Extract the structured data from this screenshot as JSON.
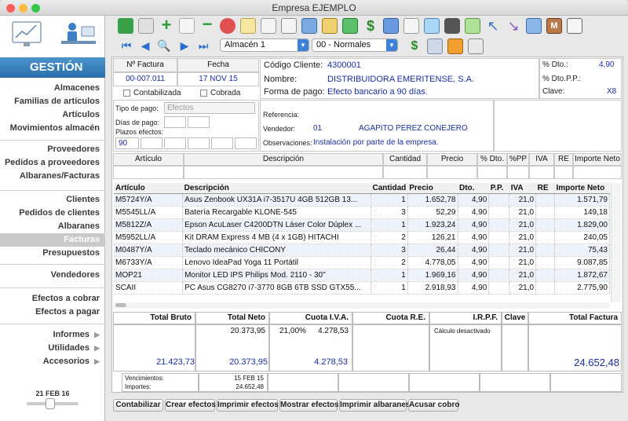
{
  "window": {
    "title": "Empresa EJEMPLO"
  },
  "sidebar": {
    "heading": "GESTIÓN",
    "group1": [
      "Almacenes",
      "Familias de artículos",
      "Artículos",
      "Movimientos almacén"
    ],
    "group2": [
      "Proveedores",
      "Pedidos a proveedores",
      "Albaranes/Facturas"
    ],
    "group3": [
      "Clientes",
      "Pedidos de clientes",
      "Albaranes",
      "Facturas",
      "Presupuestos"
    ],
    "group4": [
      "Vendedores"
    ],
    "group5": [
      "Efectos a cobrar",
      "Efectos a pagar"
    ],
    "group6": [
      "Informes",
      "Utilidades",
      "Accesorios"
    ],
    "date": "21 FEB 16"
  },
  "toolbar": {
    "almacen": "Almacén 1",
    "tarifa": "00 - Normales"
  },
  "header": {
    "nfactura_label": "Nº Factura",
    "fecha_label": "Fecha",
    "nfactura": "00-007.011",
    "fecha": "17 NOV 15",
    "contabilizada": "Contabilizada",
    "cobrada": "Cobrada",
    "codigo_label": "Código Cliente:",
    "codigo": "4300001",
    "nombre_label": "Nombre:",
    "nombre": "DISTRIBUIDORA EMERITENSE, S.A.",
    "forma_label": "Forma de pago:",
    "forma": "Efecto bancario a 90 días.",
    "dto_label": "% Dto.:",
    "dto": "4,90",
    "dtopp_label": "% Dto.P.P.:",
    "dtopp": "",
    "clave_label": "Clave:",
    "clave": "X8"
  },
  "payment": {
    "tipo_label": "Tipo de pago:",
    "tipo": "Efectos",
    "dias_label": "Días de pago:",
    "plazos_label": "Plazos efectos:",
    "plazo1": "90",
    "referencia_label": "Referencia:",
    "vendedor_label": "Vendedor:",
    "vendedor_code": "01",
    "vendedor_name": "AGAPITO PEREZ CONEJERO",
    "observ_label": "Observaciones:",
    "observ": "Instalación por parte de la empresa."
  },
  "entry_headers": [
    "Artículo",
    "Descripción",
    "Cantidad",
    "Precio",
    "% Dto.",
    "%PP",
    "IVA",
    "RE",
    "Importe Neto"
  ],
  "lines": {
    "columns": [
      "Artículo",
      "Descripción",
      "Cantidad",
      "Precio",
      "Dto.",
      "P.P.",
      "IVA",
      "RE",
      "Importe Neto"
    ],
    "rows": [
      [
        "M5724Y/A",
        "Asus Zenbook UX31A i7-3517U 4GB 512GB 13...",
        "1",
        "1.652,78",
        "4,90",
        "",
        "21,0",
        "",
        "1.571,79"
      ],
      [
        "M5545LL/A",
        "Batería Recargable KLONE-545",
        "3",
        "52,29",
        "4,90",
        "",
        "21,0",
        "",
        "149,18"
      ],
      [
        "M5812Z/A",
        "Epson AcuLaser C4200DTN Láser Color Dúplex ...",
        "1",
        "1.923,24",
        "4,90",
        "",
        "21,0",
        "",
        "1.829,00"
      ],
      [
        "M5952LL/A",
        "Kit DRAM Express 4 MB (4 x 1GB) HITACHI",
        "2",
        "126,21",
        "4,90",
        "",
        "21,0",
        "",
        "240,05"
      ],
      [
        "M0487Y/A",
        "Teclado mecánico CHICONY",
        "3",
        "26,44",
        "4,90",
        "",
        "21,0",
        "",
        "75,43"
      ],
      [
        "M6733Y/A",
        "Lenovo IdeaPad Yoga 11 Portátil",
        "2",
        "4.778,05",
        "4,90",
        "",
        "21,0",
        "",
        "9.087,85"
      ],
      [
        "MOP21",
        "Monitor LED IPS Philips Mod. 2110 - 30\"",
        "1",
        "1.969,16",
        "4,90",
        "",
        "21,0",
        "",
        "1.872,67"
      ],
      [
        "SCAII",
        "PC Asus CG8270 i7-3770 8GB 6TB SSD GTX55...",
        "1",
        "2.918,93",
        "4,90",
        "",
        "21,0",
        "",
        "2.775,90"
      ]
    ]
  },
  "totals": {
    "h_bruto": "Total Bruto",
    "h_neto": "Total Neto",
    "h_iva": "Cuota I.V.A.",
    "h_re": "Cuota R.E.",
    "h_irpf": "I.R.P.F.",
    "h_clave": "Clave",
    "h_total": "Total Factura",
    "neto_line": "20.373,95",
    "iva_pct": "21,00%",
    "iva_line": "4.278,53",
    "irpf_note": "Cálculo desactivado",
    "bruto": "21.423,73",
    "neto": "20.373,95",
    "iva": "4.278,53",
    "total": "24.652,48",
    "venc_label": "Vencimientos:",
    "imp_label": "Importes:",
    "venc": "15 FEB 15",
    "imp": "24.652,48"
  },
  "buttons": [
    "Contabilizar",
    "Crear efectos",
    "Imprimir efectos",
    "Mostrar efectos",
    "Imprimir albaranes",
    "Acusar cobro"
  ]
}
